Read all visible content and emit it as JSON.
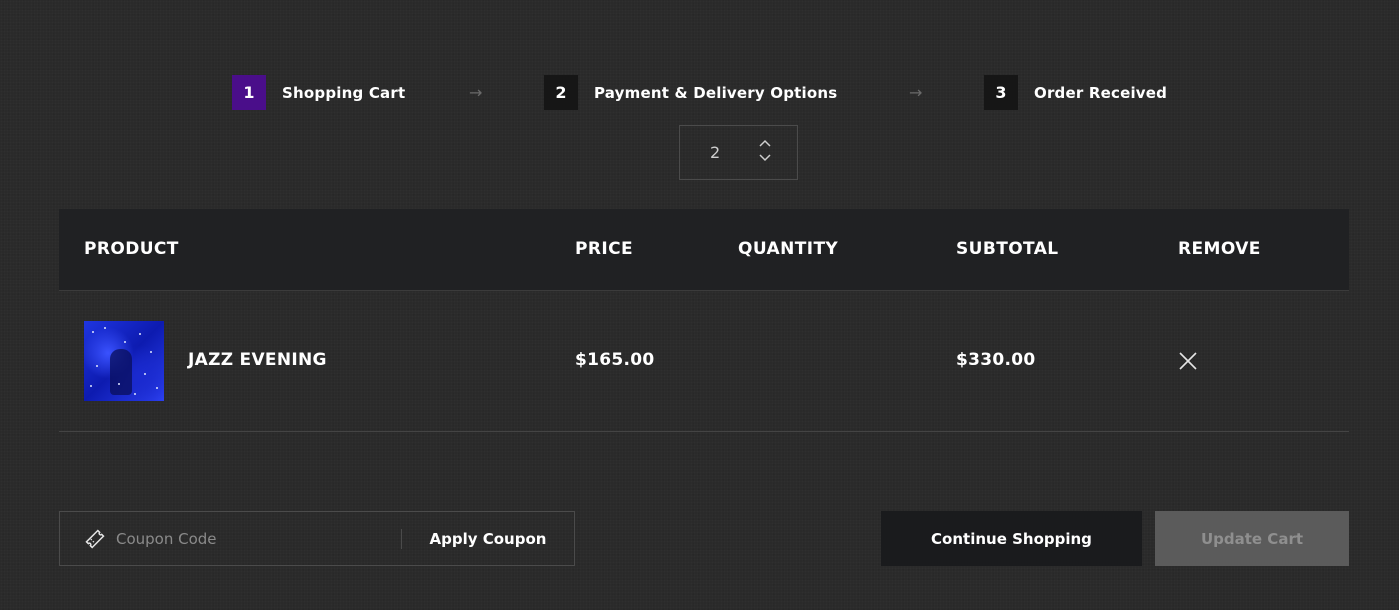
{
  "steps": [
    {
      "num": "1",
      "label": "Shopping Cart"
    },
    {
      "num": "2",
      "label": "Payment & Delivery Options"
    },
    {
      "num": "3",
      "label": "Order Received"
    }
  ],
  "table": {
    "headers": {
      "product": "PRODUCT",
      "price": "PRICE",
      "quantity": "QUANTITY",
      "subtotal": "SUBTOTAL",
      "remove": "REMOVE"
    },
    "rows": [
      {
        "name": "JAZZ EVENING",
        "price": "$165.00",
        "quantity": "2",
        "subtotal": "$330.00"
      }
    ]
  },
  "coupon": {
    "placeholder": "Coupon Code",
    "apply_label": "Apply Coupon"
  },
  "actions": {
    "continue_label": "Continue Shopping",
    "update_label": "Update Cart"
  },
  "colors": {
    "active_step": "#4a0e8a",
    "background": "#2a2a2a",
    "header_bg": "#202123"
  },
  "icons": {
    "arrow": "arrow-right-icon",
    "remove": "close-icon",
    "coupon": "ticket-icon",
    "qty_up": "chevron-up-icon",
    "qty_down": "chevron-down-icon"
  }
}
